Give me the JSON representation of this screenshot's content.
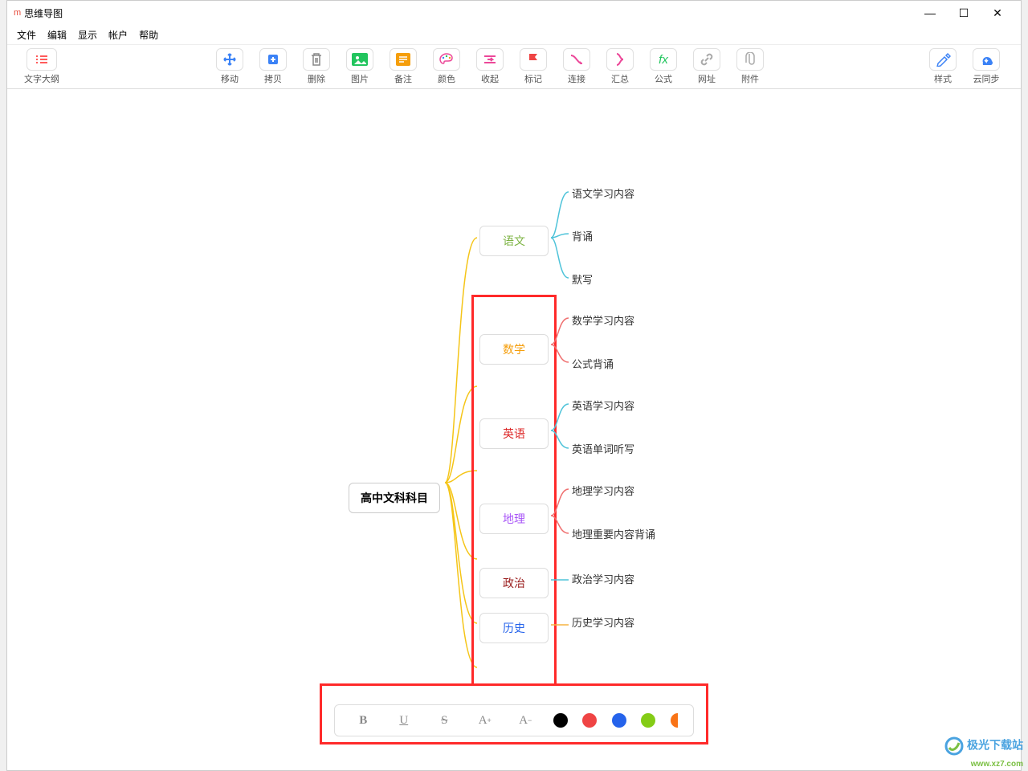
{
  "window": {
    "title": "思维导图"
  },
  "menu": {
    "file": "文件",
    "edit": "编辑",
    "view": "显示",
    "account": "帐户",
    "help": "帮助"
  },
  "toolbar": {
    "outline": "文字大纲",
    "move": "移动",
    "copy": "拷贝",
    "delete": "删除",
    "image": "图片",
    "note": "备注",
    "color": "颜色",
    "collapse": "收起",
    "flag": "标记",
    "connect": "连接",
    "summary": "汇总",
    "formula": "公式",
    "url": "网址",
    "attach": "附件",
    "style": "样式",
    "sync": "云同步"
  },
  "mindmap": {
    "root": "高中文科科目",
    "subjects": [
      {
        "label": "语文",
        "color": "#7cb342",
        "children": [
          "语文学习内容",
          "背诵",
          "默写"
        ]
      },
      {
        "label": "数学",
        "color": "#f59e0b",
        "children": [
          "数学学习内容",
          "公式背诵"
        ]
      },
      {
        "label": "英语",
        "color": "#dc2626",
        "children": [
          "英语学习内容",
          "英语单词听写"
        ]
      },
      {
        "label": "地理",
        "color": "#a855f7",
        "children": [
          "地理学习内容",
          "地理重要内容背诵"
        ]
      },
      {
        "label": "政治",
        "color": "#991b1b",
        "children": [
          "政治学习内容"
        ]
      },
      {
        "label": "历史",
        "color": "#2563eb",
        "children": [
          "历史学习内容"
        ]
      }
    ]
  },
  "format": {
    "bold": "B",
    "underline": "U",
    "strike": "S",
    "fontInc": "A+",
    "fontDec": "A-"
  },
  "watermark": {
    "brand": "极光下载站",
    "url": "www.xz7.com"
  }
}
